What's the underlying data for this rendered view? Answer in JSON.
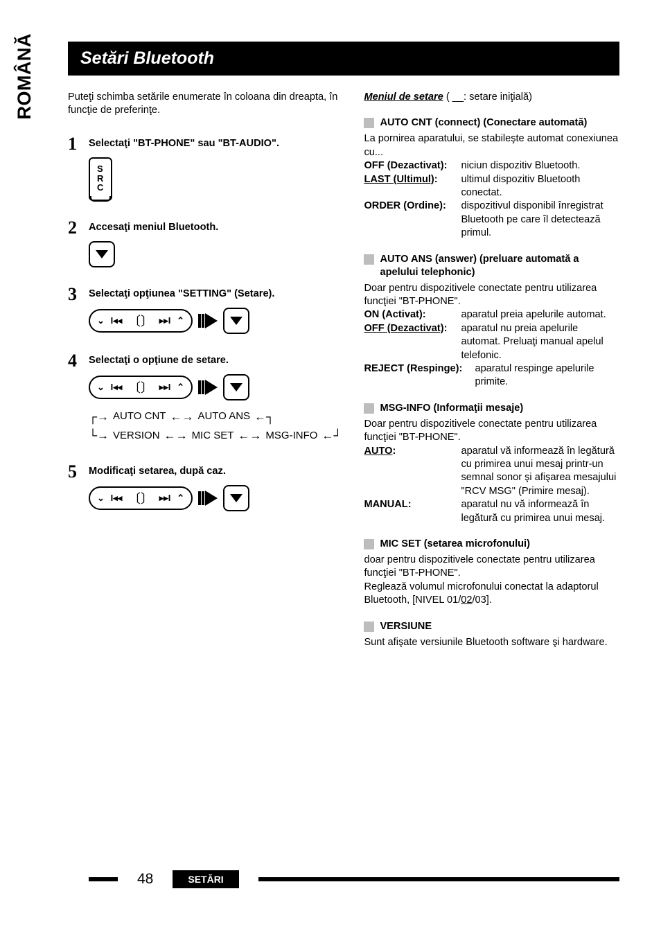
{
  "side_tab": "ROMÂNĂ",
  "title": "Setări Bluetooth",
  "intro": "Puteţi schimba setările enumerate în coloana din dreapta, în funcţie de preferinţe.",
  "steps": [
    {
      "num": "1",
      "text": "Selectaţi \"BT-PHONE\" sau \"BT-AUDIO\"."
    },
    {
      "num": "2",
      "text": "Accesaţi meniul Bluetooth."
    },
    {
      "num": "3",
      "text": "Selectaţi opţiunea \"SETTING\" (Setare)."
    },
    {
      "num": "4",
      "text": "Selectaţi o opţiune de setare."
    },
    {
      "num": "5",
      "text": "Modificaţi setarea, după caz."
    }
  ],
  "src_label": "S\nR\nC",
  "flow": {
    "row1": [
      "AUTO CNT",
      "AUTO ANS"
    ],
    "row2": [
      "VERSION",
      "MIC SET",
      "MSG-INFO"
    ]
  },
  "right": {
    "menu_head": "Meniul de setare",
    "menu_note": " ( __: setare iniţială)",
    "auto_cnt": {
      "title": "AUTO CNT (connect) (Conectare automată)",
      "desc": "La pornirea aparatului, se stabileşte automat conexiunea cu...",
      "items": [
        {
          "term": "OFF (Dezactivat)",
          "sep": ":",
          "desc": "niciun dispozitiv Bluetooth.",
          "ul": false
        },
        {
          "term": "LAST (Ultimul)",
          "sep": ":",
          "desc": "ultimul dispozitiv Bluetooth conectat.",
          "ul": true
        },
        {
          "term": "ORDER (Ordine)",
          "sep": ":",
          "desc": "dispozitivul disponibil înregistrat Bluetooth pe care îl detectează primul.",
          "ul": false
        }
      ]
    },
    "auto_ans": {
      "title": "AUTO ANS (answer) (preluare automată a apelului telephonic)",
      "desc": "Doar pentru dispozitivele conectate pentru utilizarea funcţiei \"BT-PHONE\".",
      "items": [
        {
          "term": "ON (Activat)",
          "sep": ":",
          "desc": "aparatul preia apelurile automat.",
          "ul": false
        },
        {
          "term": "OFF (Dezactivat)",
          "sep": ":",
          "desc": "aparatul nu preia apelurile automat. Preluaţi manual apelul telefonic.",
          "ul": true
        },
        {
          "term": "REJECT (Respinge)",
          "sep": ":",
          "desc": "aparatul respinge apelurile primite.",
          "ul": false
        }
      ]
    },
    "msg_info": {
      "title": "MSG-INFO (Informaţii mesaje)",
      "desc": "Doar pentru dispozitivele conectate pentru utilizarea funcţiei \"BT-PHONE\".",
      "items": [
        {
          "term": "AUTO",
          "sep": ":",
          "desc": "aparatul vă informează în legătură cu primirea unui mesaj printr-un semnal sonor şi afişarea mesajului \"RCV MSG\" (Primire mesaj).",
          "ul": true
        },
        {
          "term": "MANUAL",
          "sep": ":",
          "desc": "aparatul nu vă informează în legătură cu primirea unui mesaj.",
          "ul": false
        }
      ]
    },
    "mic_set": {
      "title": "MIC SET (setarea microfonului)",
      "desc1": "doar pentru dispozitivele conectate pentru utilizarea funcţiei \"BT-PHONE\".",
      "desc2_pre": "Reglează volumul microfonului conectat la adaptorul Bluetooth, [NIVEL 01/",
      "desc2_ul": "02",
      "desc2_post": "/03]."
    },
    "version": {
      "title": "VERSIUNE",
      "desc": "Sunt afişate versiunile Bluetooth software şi hardware."
    }
  },
  "footer": {
    "page": "48",
    "label": "SETĂRI"
  }
}
